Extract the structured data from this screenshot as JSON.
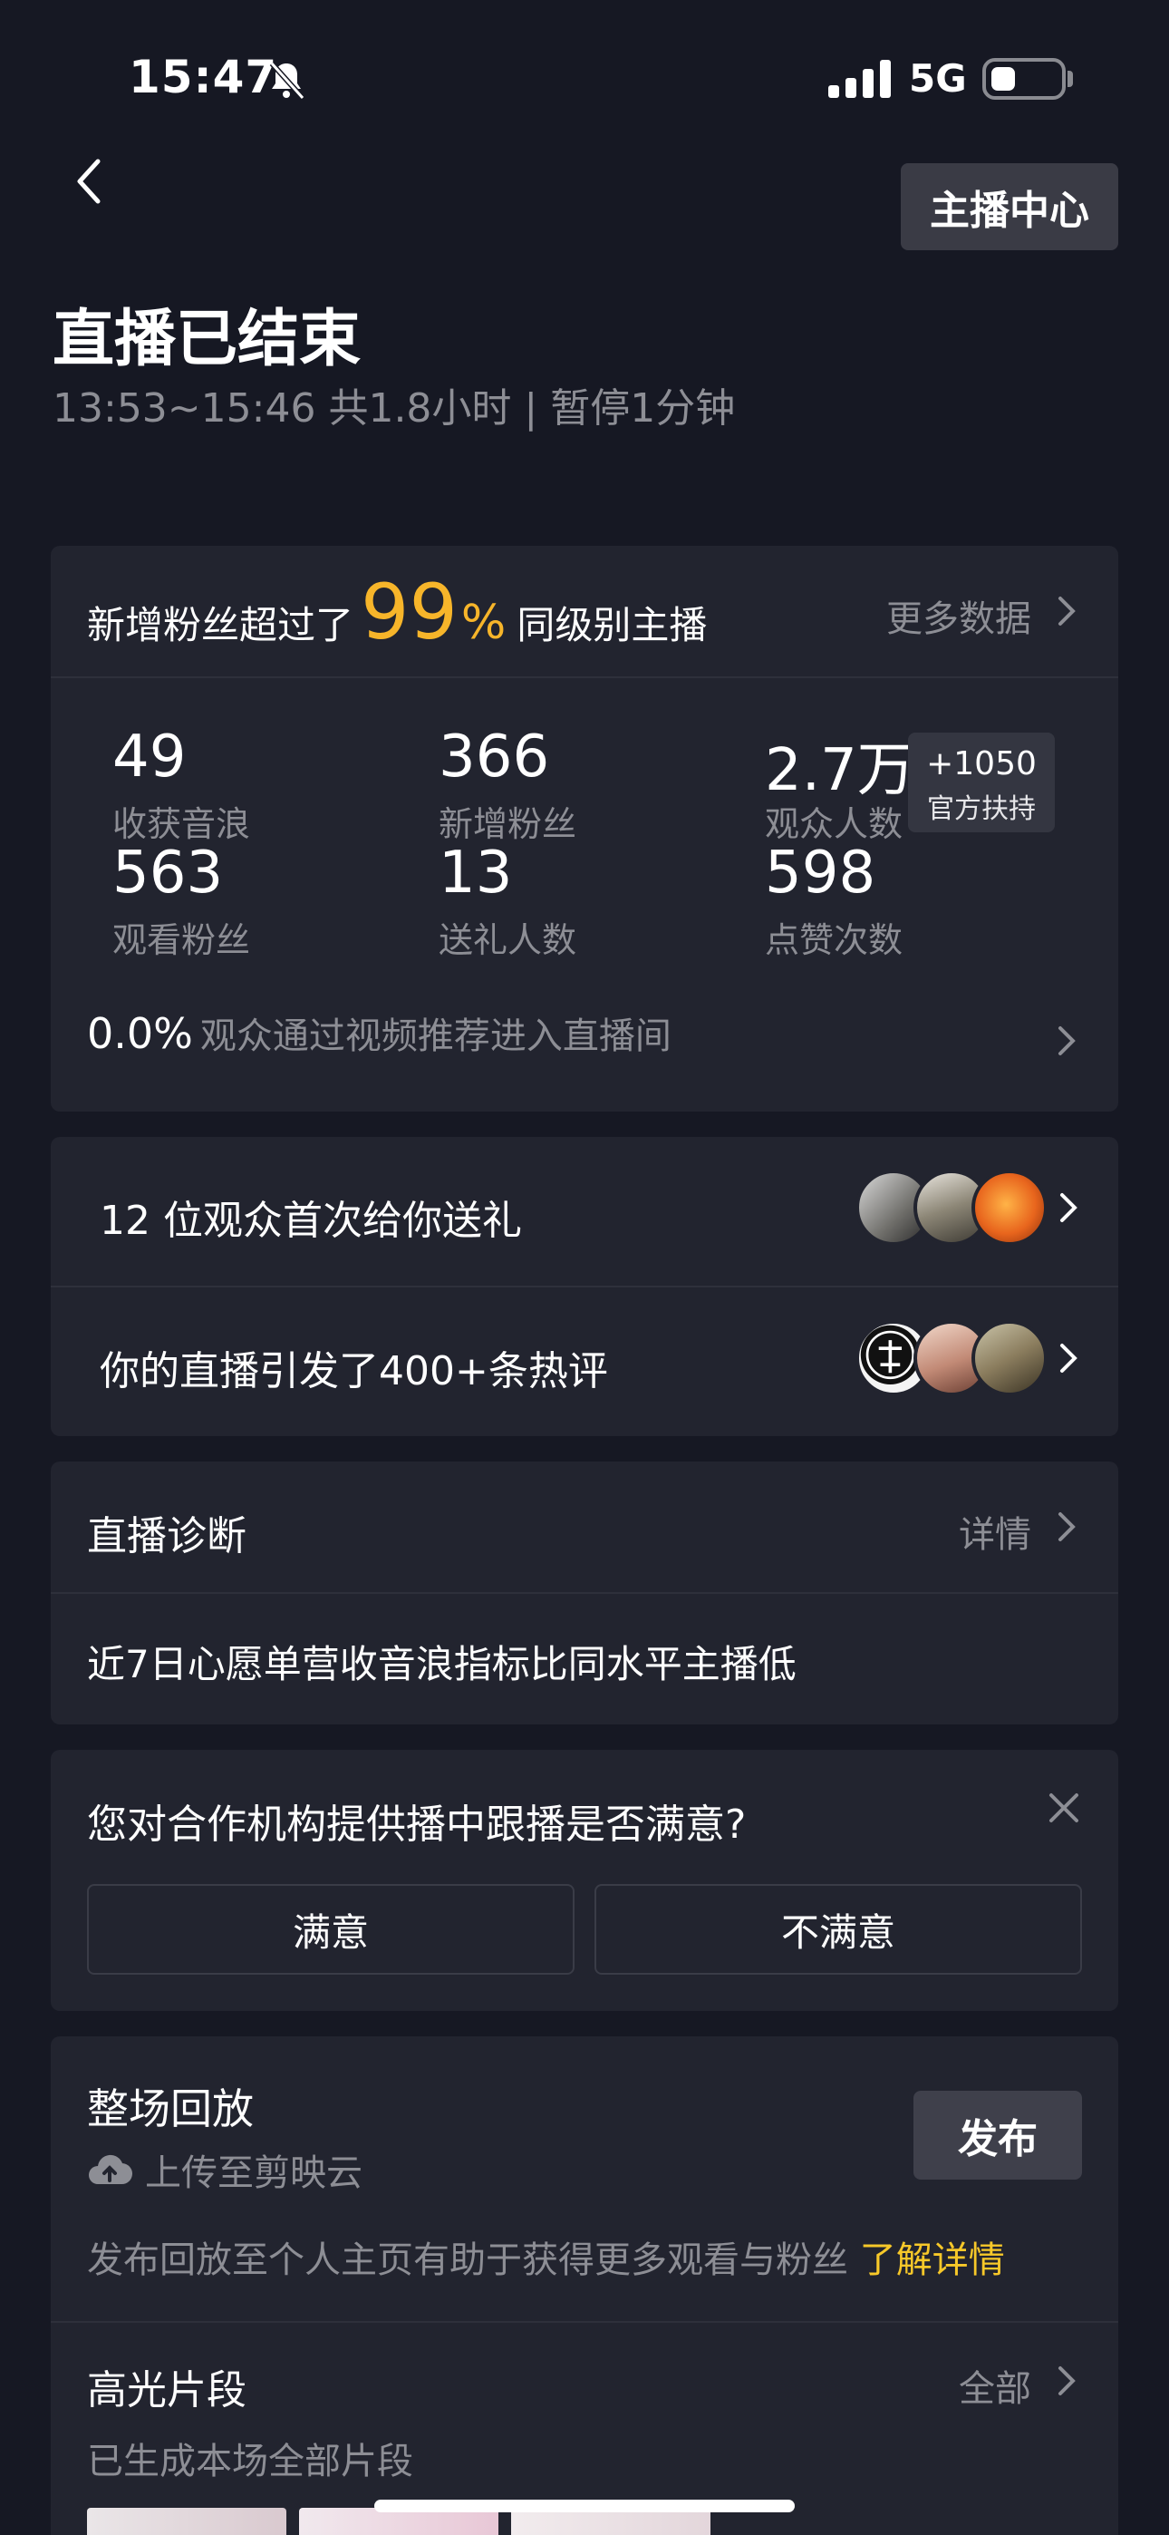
{
  "status_bar": {
    "time": "15:47",
    "network": "5G"
  },
  "header": {
    "anchor_center_label": "主播中心",
    "title": "直播已结束",
    "subtitle": "13:53~15:46 共1.8小时 | 暂停1分钟"
  },
  "stats": {
    "prefix": "新增粉丝超过了",
    "percent": "99",
    "percent_sign": "%",
    "suffix": "同级别主播",
    "more_label": "更多数据",
    "items": [
      {
        "value": "49",
        "label": "收获音浪"
      },
      {
        "value": "366",
        "label": "新增粉丝"
      },
      {
        "value": "2.7万",
        "label": "观众人数"
      },
      {
        "value": "563",
        "label": "观看粉丝"
      },
      {
        "value": "13",
        "label": "送礼人数"
      },
      {
        "value": "598",
        "label": "点赞次数"
      }
    ],
    "badge": {
      "line1": "+1050",
      "line2": "官方扶持"
    },
    "recommend_pct": "0.0%",
    "recommend_text": "观众通过视频推荐进入直播间"
  },
  "social": {
    "gifts_text": "12 位观众首次给你送礼",
    "comments_text": "你的直播引发了400+条热评"
  },
  "diagnosis": {
    "title": "直播诊断",
    "detail_label": "详情",
    "text": "近7日心愿单营收音浪指标比同水平主播低"
  },
  "survey": {
    "question": "您对合作机构提供播中跟播是否满意?",
    "satisfied": "满意",
    "unsatisfied": "不满意"
  },
  "replay": {
    "title": "整场回放",
    "cloud_label": "上传至剪映云",
    "publish_label": "发布",
    "tip": "发布回放至个人主页有助于获得更多观看与粉丝",
    "tip_link": "了解详情",
    "highlights_title": "高光片段",
    "highlights_all": "全部",
    "highlights_sub": "已生成本场全部片段"
  },
  "colors": {
    "background": "#161823",
    "card": "#22242f",
    "accent_gold": "#f7b52a",
    "muted": "#8d8e95"
  }
}
